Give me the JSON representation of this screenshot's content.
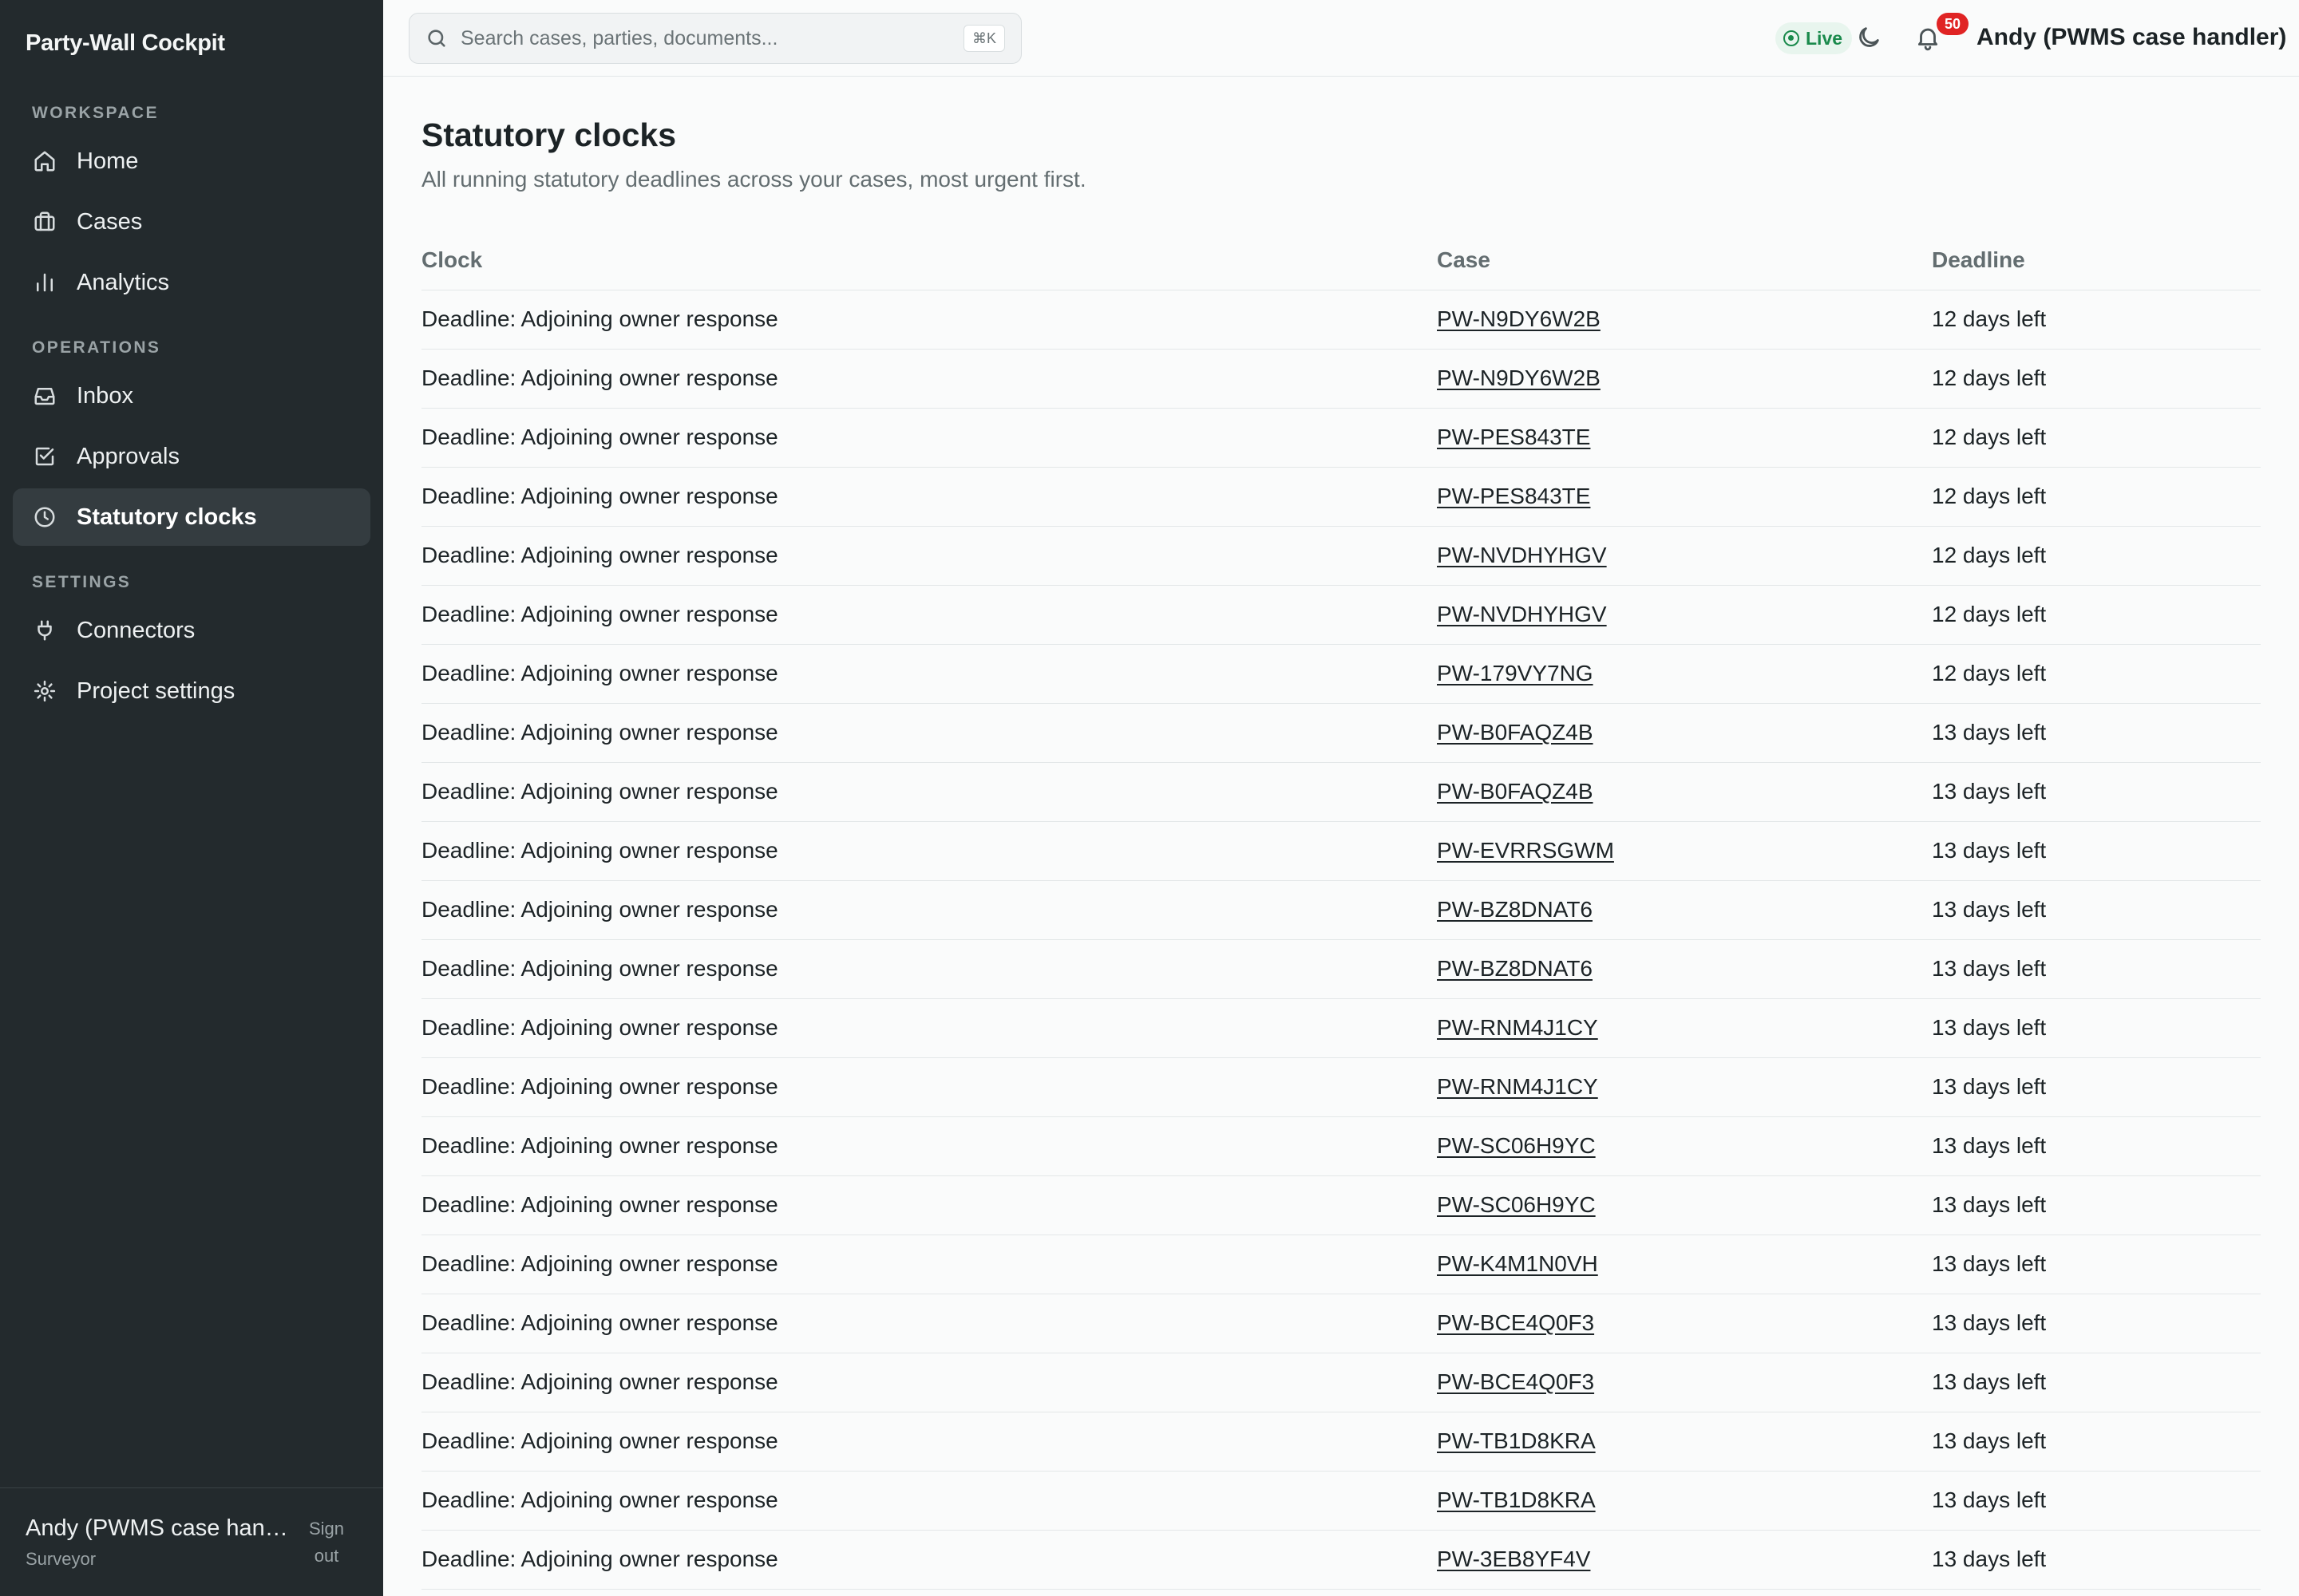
{
  "app": {
    "title": "Party-Wall Cockpit"
  },
  "sidebar": {
    "sections": [
      {
        "label": "WORKSPACE",
        "items": [
          {
            "label": "Home",
            "icon": "home-icon"
          },
          {
            "label": "Cases",
            "icon": "briefcase-icon"
          },
          {
            "label": "Analytics",
            "icon": "bar-chart-icon"
          }
        ]
      },
      {
        "label": "OPERATIONS",
        "items": [
          {
            "label": "Inbox",
            "icon": "inbox-icon"
          },
          {
            "label": "Approvals",
            "icon": "check-square-icon"
          },
          {
            "label": "Statutory clocks",
            "icon": "clock-icon",
            "active": true
          }
        ]
      },
      {
        "label": "SETTINGS",
        "items": [
          {
            "label": "Connectors",
            "icon": "plug-icon"
          },
          {
            "label": "Project settings",
            "icon": "gear-icon"
          }
        ]
      }
    ],
    "footer": {
      "name": "Andy (PWMS case handler)",
      "role": "Surveyor",
      "signout_label": "Sign out"
    }
  },
  "header": {
    "search_placeholder": "Search cases, parties, documents...",
    "search_shortcut": "⌘K",
    "live_label": "Live",
    "notification_count": "50",
    "user_name": "Andy (PWMS case handler)"
  },
  "page": {
    "title": "Statutory clocks",
    "subtitle": "All running statutory deadlines across your cases, most urgent first."
  },
  "table": {
    "columns": [
      "Clock",
      "Case",
      "Deadline"
    ],
    "rows": [
      {
        "clock": "Deadline: Adjoining owner response",
        "case": "PW-N9DY6W2B",
        "deadline": "12 days left"
      },
      {
        "clock": "Deadline: Adjoining owner response",
        "case": "PW-N9DY6W2B",
        "deadline": "12 days left"
      },
      {
        "clock": "Deadline: Adjoining owner response",
        "case": "PW-PES843TE",
        "deadline": "12 days left"
      },
      {
        "clock": "Deadline: Adjoining owner response",
        "case": "PW-PES843TE",
        "deadline": "12 days left"
      },
      {
        "clock": "Deadline: Adjoining owner response",
        "case": "PW-NVDHYHGV",
        "deadline": "12 days left"
      },
      {
        "clock": "Deadline: Adjoining owner response",
        "case": "PW-NVDHYHGV",
        "deadline": "12 days left"
      },
      {
        "clock": "Deadline: Adjoining owner response",
        "case": "PW-179VY7NG",
        "deadline": "12 days left"
      },
      {
        "clock": "Deadline: Adjoining owner response",
        "case": "PW-B0FAQZ4B",
        "deadline": "13 days left"
      },
      {
        "clock": "Deadline: Adjoining owner response",
        "case": "PW-B0FAQZ4B",
        "deadline": "13 days left"
      },
      {
        "clock": "Deadline: Adjoining owner response",
        "case": "PW-EVRRSGWM",
        "deadline": "13 days left"
      },
      {
        "clock": "Deadline: Adjoining owner response",
        "case": "PW-BZ8DNAT6",
        "deadline": "13 days left"
      },
      {
        "clock": "Deadline: Adjoining owner response",
        "case": "PW-BZ8DNAT6",
        "deadline": "13 days left"
      },
      {
        "clock": "Deadline: Adjoining owner response",
        "case": "PW-RNM4J1CY",
        "deadline": "13 days left"
      },
      {
        "clock": "Deadline: Adjoining owner response",
        "case": "PW-RNM4J1CY",
        "deadline": "13 days left"
      },
      {
        "clock": "Deadline: Adjoining owner response",
        "case": "PW-SC06H9YC",
        "deadline": "13 days left"
      },
      {
        "clock": "Deadline: Adjoining owner response",
        "case": "PW-SC06H9YC",
        "deadline": "13 days left"
      },
      {
        "clock": "Deadline: Adjoining owner response",
        "case": "PW-K4M1N0VH",
        "deadline": "13 days left"
      },
      {
        "clock": "Deadline: Adjoining owner response",
        "case": "PW-BCE4Q0F3",
        "deadline": "13 days left"
      },
      {
        "clock": "Deadline: Adjoining owner response",
        "case": "PW-BCE4Q0F3",
        "deadline": "13 days left"
      },
      {
        "clock": "Deadline: Adjoining owner response",
        "case": "PW-TB1D8KRA",
        "deadline": "13 days left"
      },
      {
        "clock": "Deadline: Adjoining owner response",
        "case": "PW-TB1D8KRA",
        "deadline": "13 days left"
      },
      {
        "clock": "Deadline: Adjoining owner response",
        "case": "PW-3EB8YF4V",
        "deadline": "13 days left"
      }
    ]
  }
}
